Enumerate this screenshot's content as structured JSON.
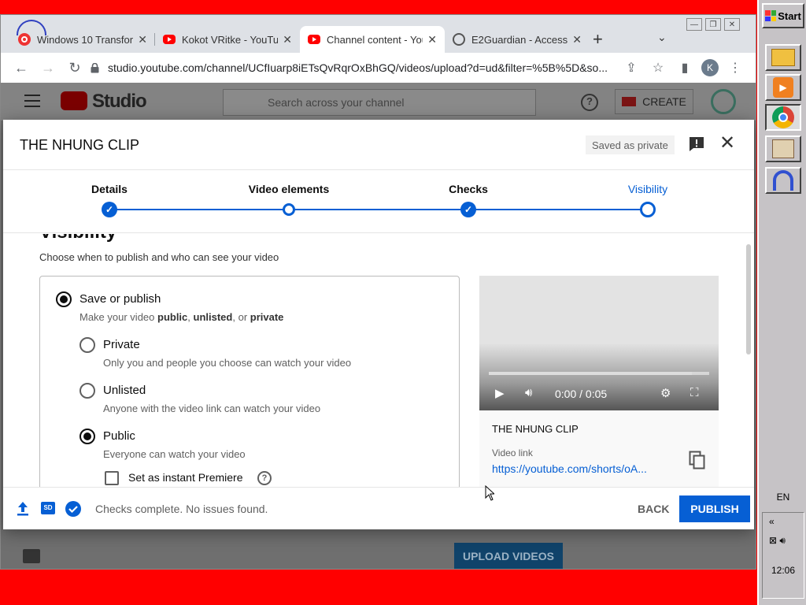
{
  "taskbar": {
    "start_label": "Start",
    "apps": [
      "explorer-icon",
      "media-player-icon",
      "chrome-icon",
      "paint-icon",
      "headphones-icon"
    ],
    "language": "EN",
    "chevron": "«",
    "clock": "12:06"
  },
  "browser": {
    "tabs": [
      {
        "title": "Windows 10 Transform",
        "icon": "opera-icon",
        "active": false
      },
      {
        "title": "Kokot VRitke - YouTub",
        "icon": "youtube-icon",
        "active": false
      },
      {
        "title": "Channel content - You",
        "icon": "youtube-icon",
        "active": true
      },
      {
        "title": "E2Guardian - Access D",
        "icon": "globe-icon",
        "active": false
      }
    ],
    "url": "studio.youtube.com/channel/UCfIuarp8iETsQvRqrOxBhGQ/videos/upload?d=ud&filter=%5B%5D&so...",
    "profile_initial": "K"
  },
  "studio": {
    "logo_text": "Studio",
    "search_placeholder": "Search across your channel",
    "create_label": "CREATE",
    "upload_videos_label": "UPLOAD VIDEOS"
  },
  "dialog": {
    "title": "THE NHUNG CLIP",
    "saved_chip": "Saved as private",
    "steps": [
      {
        "label": "Details",
        "state": "done"
      },
      {
        "label": "Video elements",
        "state": "ring"
      },
      {
        "label": "Checks",
        "state": "done"
      },
      {
        "label": "Visibility",
        "state": "active"
      }
    ],
    "heading": "Visibility",
    "subheading": "Choose when to publish and who can see your video",
    "save_or_publish": {
      "label": "Save or publish",
      "desc_prefix": "Make your video ",
      "desc_public": "public",
      "desc_sep1": ", ",
      "desc_unlisted": "unlisted",
      "desc_sep2": ", or ",
      "desc_private": "private"
    },
    "options": [
      {
        "label": "Private",
        "desc": "Only you and people you choose can watch your video",
        "selected": false
      },
      {
        "label": "Unlisted",
        "desc": "Anyone with the video link can watch your video",
        "selected": false
      },
      {
        "label": "Public",
        "desc": "Everyone can watch your video",
        "selected": true
      }
    ],
    "premiere_label": "Set as instant Premiere",
    "preview": {
      "time": "0:00 / 0:05",
      "progress_fraction": 0.92,
      "clip_title": "THE NHUNG CLIP",
      "video_link_label": "Video link",
      "video_link": "https://youtube.com/shorts/oA..."
    },
    "footer": {
      "checks_message": "Checks complete. No issues found.",
      "sd_badge": "SD",
      "back_label": "BACK",
      "publish_label": "PUBLISH"
    }
  }
}
